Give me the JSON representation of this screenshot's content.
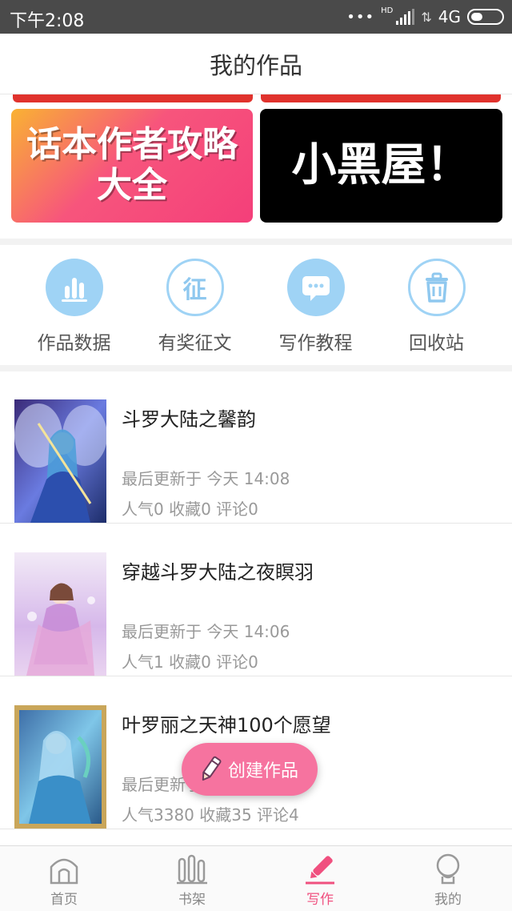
{
  "status_bar": {
    "time": "下午2:08",
    "dots": "•••",
    "network": "4G",
    "hd": "HD"
  },
  "header": {
    "title": "我的作品"
  },
  "banners": [
    {
      "text": "话本作者攻略大全",
      "line1": "话本作者攻略",
      "line2": "大全"
    },
    {
      "text": "小黑屋！"
    }
  ],
  "shortcuts": [
    {
      "label": "作品数据",
      "icon": "bar-chart-icon"
    },
    {
      "label": "有奖征文",
      "icon": "contest-icon",
      "glyph": "征"
    },
    {
      "label": "写作教程",
      "icon": "chat-bubble-icon"
    },
    {
      "label": "回收站",
      "icon": "trash-icon"
    }
  ],
  "works": [
    {
      "title": "斗罗大陆之馨韵",
      "updated": "最后更新于 今天 14:08",
      "stats": "人气0  收藏0  评论0"
    },
    {
      "title": "穿越斗罗大陆之夜瞑羽",
      "updated": "最后更新于 今天 14:06",
      "stats": "人气1  收藏0  评论0"
    },
    {
      "title": "叶罗丽之天神100个愿望",
      "updated": "最后更新于",
      "stats": "人气3380  收藏35  评论4"
    }
  ],
  "fab": {
    "label": "创建作品",
    "icon": "pencil-icon"
  },
  "tabs": [
    {
      "label": "首页",
      "icon": "home-icon",
      "active": false
    },
    {
      "label": "书架",
      "icon": "bookshelf-icon",
      "active": false
    },
    {
      "label": "写作",
      "icon": "pencil-icon",
      "active": true
    },
    {
      "label": "我的",
      "icon": "profile-icon",
      "active": false
    }
  ],
  "colors": {
    "accent": "#f0507f",
    "icon_blue": "#9fd3f5",
    "fab": "#f6739f",
    "status_bar": "#4a4a4a"
  }
}
